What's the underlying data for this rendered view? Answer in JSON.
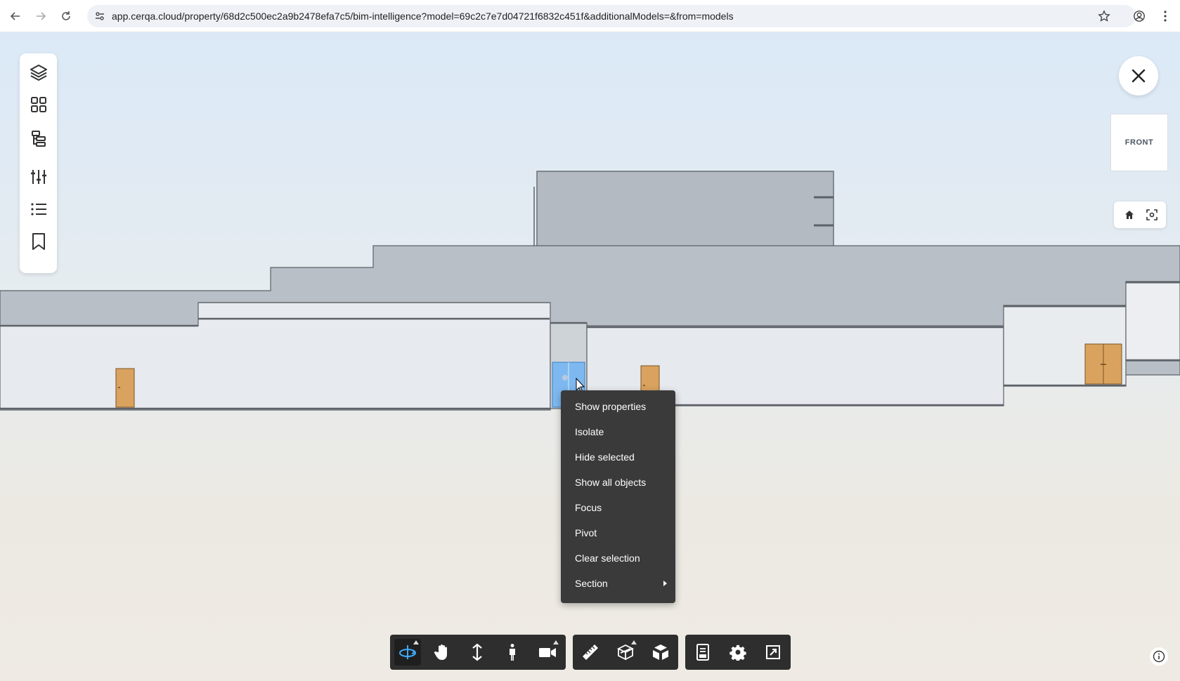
{
  "browser": {
    "url": "app.cerqa.cloud/property/68d2c500ec2a9b2478efa7c5/bim-intelligence?model=69c2c7e7d04721f6832c451f&additionalModels=&from=models"
  },
  "left_panel": {
    "items": [
      {
        "icon": "layers-icon"
      },
      {
        "icon": "grid-icon"
      },
      {
        "icon": "hierarchy-icon"
      },
      {
        "icon": "sliders-icon"
      },
      {
        "icon": "list-icon"
      },
      {
        "icon": "bookmark-icon"
      }
    ]
  },
  "viewcube": {
    "face_label": "FRONT"
  },
  "context_menu": {
    "items": [
      {
        "label": "Show properties"
      },
      {
        "label": "Isolate"
      },
      {
        "label": "Hide selected"
      },
      {
        "label": "Show all objects"
      },
      {
        "label": "Focus"
      },
      {
        "label": "Pivot"
      },
      {
        "label": "Clear selection"
      },
      {
        "label": "Section",
        "has_submenu": true
      }
    ]
  },
  "toolbar": {
    "navigation": [
      {
        "icon": "orbit-icon",
        "active": true,
        "has_flyout": true
      },
      {
        "icon": "pan-hand-icon"
      },
      {
        "icon": "zoom-arrows-icon"
      },
      {
        "icon": "walk-person-icon"
      },
      {
        "icon": "camera-icon",
        "has_flyout": true
      }
    ],
    "tools": [
      {
        "icon": "measure-ruler-icon"
      },
      {
        "icon": "section-box-icon",
        "has_flyout": true
      },
      {
        "icon": "explode-cube-icon"
      }
    ],
    "settings": [
      {
        "icon": "model-browser-icon"
      },
      {
        "icon": "settings-gear-icon"
      },
      {
        "icon": "fullscreen-icon"
      }
    ]
  },
  "colors": {
    "accent": "#3fa9f5",
    "menu_bg": "#3a3a3a",
    "toolbar_bg": "#2e2e2e",
    "door": "#d9a35f",
    "selection": "#7db9f0"
  }
}
